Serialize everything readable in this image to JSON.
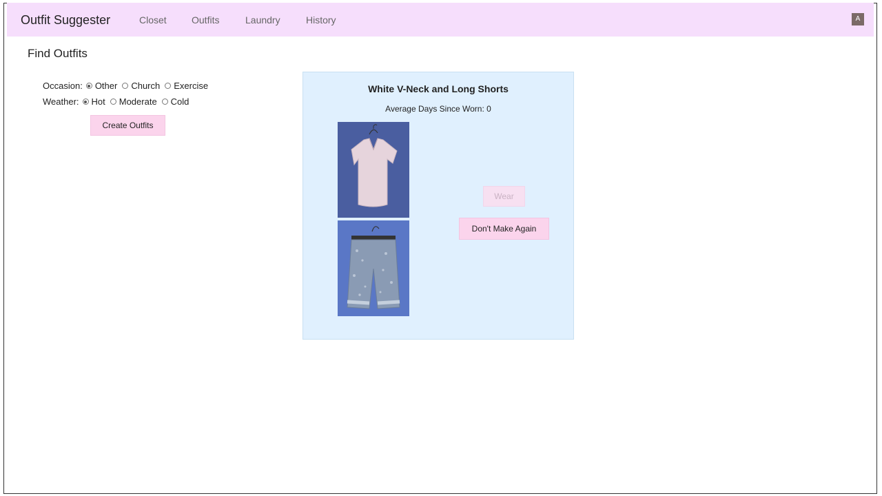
{
  "app": {
    "title": "Outfit Suggester"
  },
  "nav": {
    "links": [
      "Closet",
      "Outfits",
      "Laundry",
      "History"
    ],
    "avatar": "A"
  },
  "page": {
    "title": "Find Outfits"
  },
  "filters": {
    "occasion": {
      "label": "Occasion:",
      "options": [
        "Other",
        "Church",
        "Exercise"
      ],
      "selected": "Other"
    },
    "weather": {
      "label": "Weather:",
      "options": [
        "Hot",
        "Moderate",
        "Cold"
      ],
      "selected": "Hot"
    },
    "create_label": "Create Outfits"
  },
  "outfit": {
    "title": "White V-Neck and Long Shorts",
    "days_label": "Average Days Since Worn: 0",
    "wear_label": "Wear",
    "dont_make_label": "Don't Make Again"
  },
  "colors": {
    "navbar": "#f6defc",
    "card": "#e0f0fe",
    "button": "#fbd4ec",
    "photo_backdrop": "#4a5ea0"
  }
}
